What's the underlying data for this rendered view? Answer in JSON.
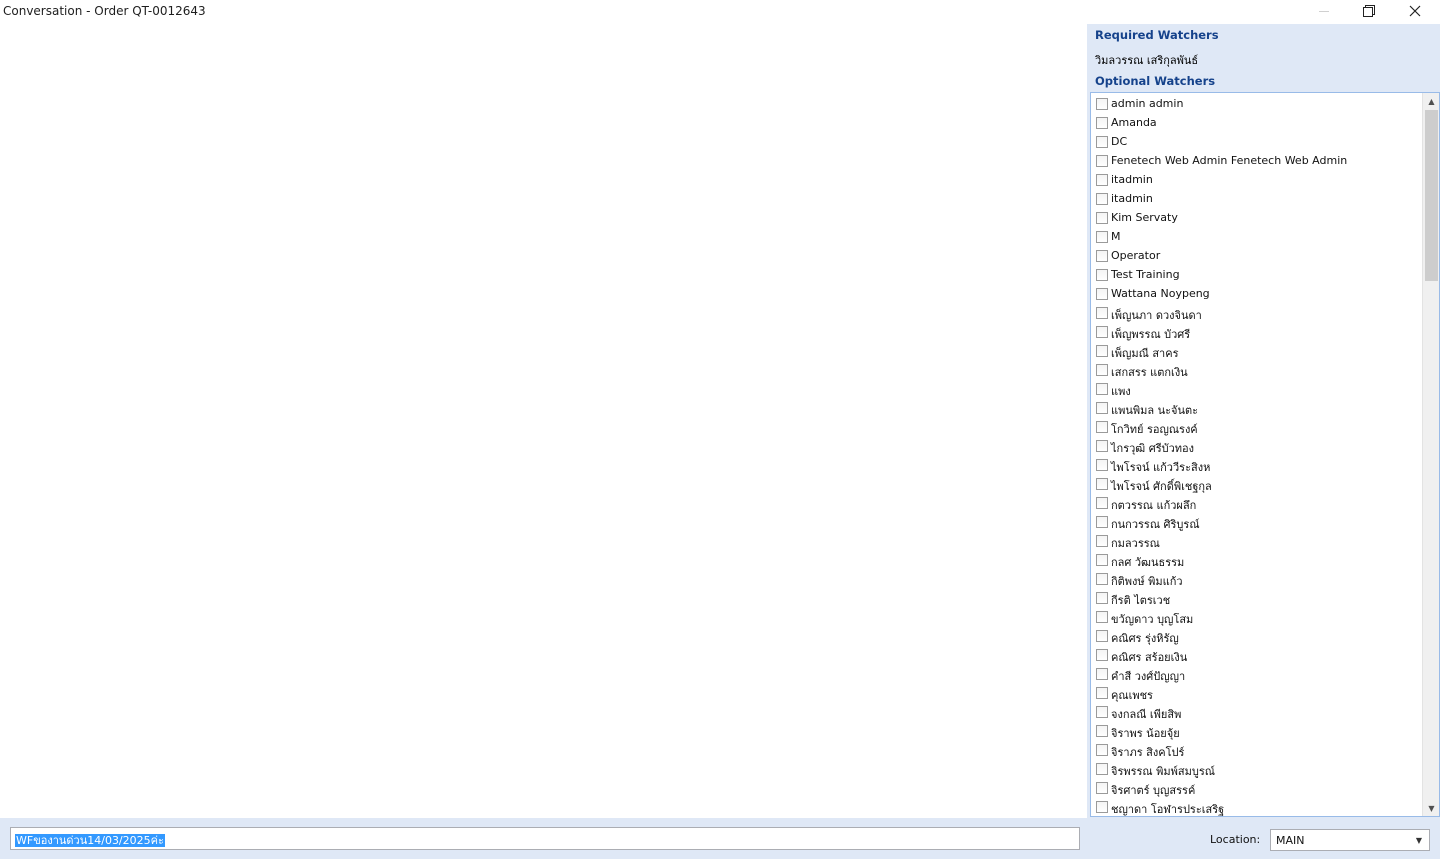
{
  "window": {
    "title": "Conversation - Order QT-0012643"
  },
  "watchers": {
    "required_header": "Required Watchers",
    "required": [
      "วิมลวรรณ เสริกุลพันธ์"
    ],
    "optional_header": "Optional Watchers",
    "optional": [
      "admin admin",
      "Amanda",
      "DC",
      "Fenetech Web Admin Fenetech Web Admin",
      "itadmin",
      "itadmin",
      "Kim Servaty",
      "M",
      "Operator",
      "Test Training",
      "Wattana Noypeng",
      "เพ็ญนภา ดวงจินดา",
      "เพ็ญพรรณ บัวศรี",
      "เพ็ญมณี สาคร",
      "เสกสรร แตกเงิน",
      "แพง",
      "แพนพิมล นะจันตะ",
      "โกวิทย์ รอญณรงค์",
      "ไกรวุฒิ ศรีบัวทอง",
      "ไพโรจน์ แก้ววีระสิงห",
      "ไพโรจน์ ศักดิ์พิเชฐกุล",
      "กตวรรณ แก้วผลึก",
      "กนกวรรณ ศิริบูรณ์",
      "กมลวรรณ",
      "กลศ วัฒนธรรม",
      "กิติพงษ์  พิมแก้ว",
      "กีรติ  ไตรเวช",
      "ขวัญดาว บุญโสม",
      "คณิศร รุ่งหิรัญ",
      "คณิศร สร้อยเงิน",
      "คำสี วงศ์ปัญญา",
      "คุณเพชร",
      "จงกลณี  เพียสิพ",
      "จิราพร น้อยจุ้ย",
      "จิราภร สิงคโปร์",
      "จิรพรรณ พิมพ์สมบูรณ์",
      "จิรศาตร์ บุญสรรค์",
      "ชญาดา โอฬารประเสริฐ"
    ]
  },
  "message": {
    "value": "WFของานด่วน14/03/2025ค่ะ"
  },
  "location": {
    "label": "Location:",
    "value": "MAIN"
  },
  "icons": {
    "minimize": "minimize-icon",
    "maximize": "restore-icon",
    "close": "close-icon",
    "scroll_up": "scroll-up-arrow-icon",
    "scroll_down": "scroll-down-arrow-icon",
    "dropdown": "chevron-down-icon"
  },
  "colors": {
    "panel_bg": "#dfe8f6",
    "header_text": "#15428b",
    "selection": "#3399ff"
  }
}
